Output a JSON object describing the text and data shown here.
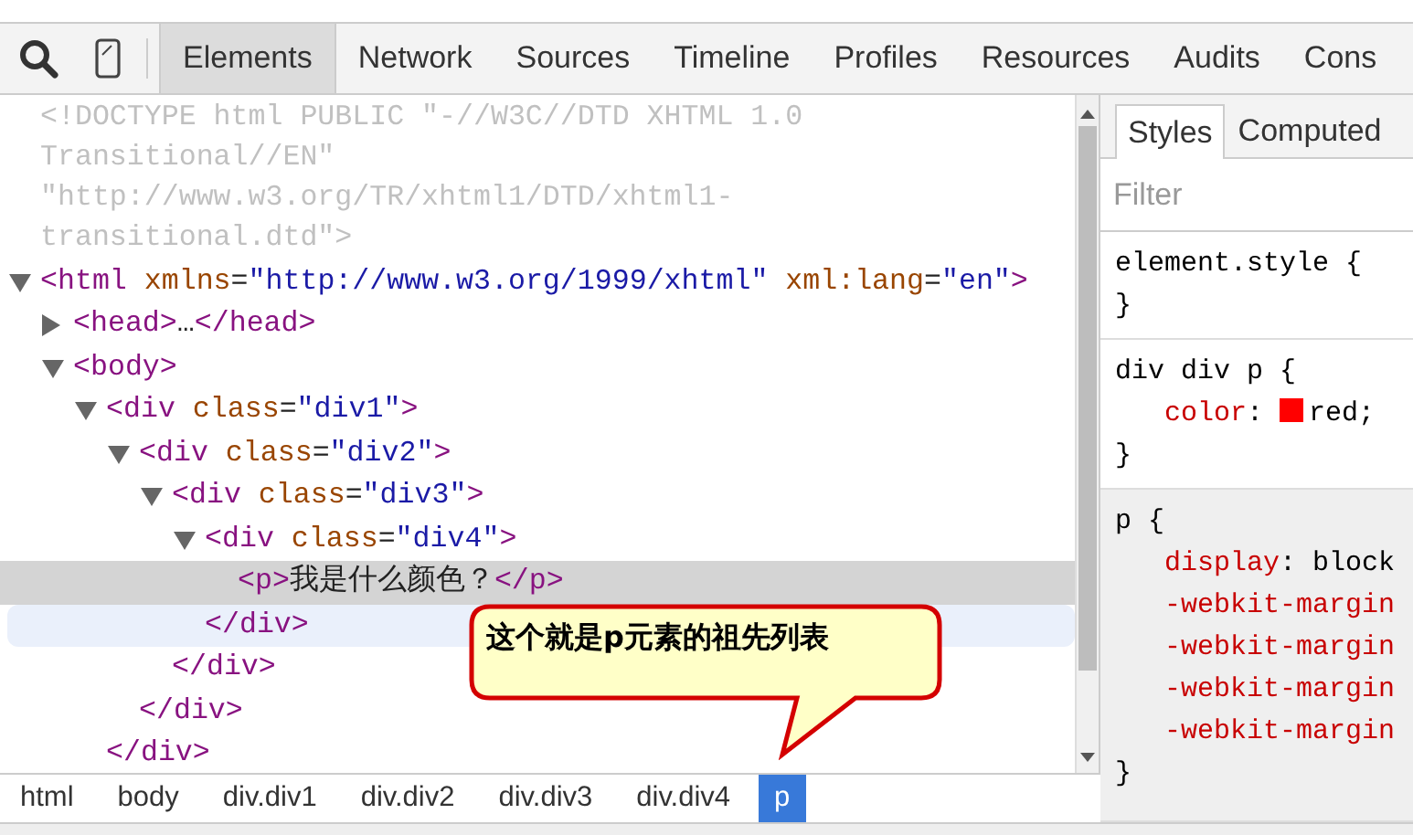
{
  "toolbar": {
    "tabs": [
      {
        "label": "Elements",
        "selected": true
      },
      {
        "label": "Network",
        "selected": false
      },
      {
        "label": "Sources",
        "selected": false
      },
      {
        "label": "Timeline",
        "selected": false
      },
      {
        "label": "Profiles",
        "selected": false
      },
      {
        "label": "Resources",
        "selected": false
      },
      {
        "label": "Audits",
        "selected": false
      },
      {
        "label": "Cons",
        "selected": false
      }
    ]
  },
  "elements_panel": {
    "nodes": [
      {
        "kind": "doctype",
        "selected": false,
        "tokens": [
          {
            "kind": "doctype",
            "text": "<!DOCTYPE html PUBLIC \"-//W3C//DTD XHTML 1.0 Transitional//EN\" \"http://www.w3.org/TR/xhtml1/DTD/xhtml1-transitional.dtd\">"
          }
        ]
      },
      {
        "kind": "element",
        "expanded": true,
        "selected": false,
        "tokens": [
          {
            "kind": "tag",
            "text": "<html"
          },
          {
            "kind": "attr",
            "text": " xmlns"
          },
          {
            "kind": "punct",
            "text": "="
          },
          {
            "kind": "value",
            "text": "\"http://www.w3.org/1999/xhtml\""
          },
          {
            "kind": "attr",
            "text": " xml:lang"
          },
          {
            "kind": "punct",
            "text": "="
          },
          {
            "kind": "value",
            "text": "\"en\""
          },
          {
            "kind": "tag",
            "text": ">"
          }
        ],
        "children": [
          {
            "kind": "element",
            "expanded": false,
            "selected": false,
            "tokens": [
              {
                "kind": "tag",
                "text": "<head>"
              },
              {
                "kind": "text",
                "text": "…"
              },
              {
                "kind": "tag",
                "text": "</head>"
              }
            ]
          },
          {
            "kind": "element",
            "expanded": true,
            "selected": false,
            "tokens": [
              {
                "kind": "tag",
                "text": "<body>"
              }
            ],
            "children": [
              {
                "kind": "element",
                "expanded": true,
                "selected": false,
                "tokens": [
                  {
                    "kind": "tag",
                    "text": "<div"
                  },
                  {
                    "kind": "attr",
                    "text": " class"
                  },
                  {
                    "kind": "punct",
                    "text": "="
                  },
                  {
                    "kind": "value",
                    "text": "\"div1\""
                  },
                  {
                    "kind": "tag",
                    "text": ">"
                  }
                ],
                "closing": {
                  "hovered": false,
                  "tokens": [
                    {
                      "kind": "tag",
                      "text": "</div>"
                    }
                  ]
                },
                "children": [
                  {
                    "kind": "element",
                    "expanded": true,
                    "selected": false,
                    "tokens": [
                      {
                        "kind": "tag",
                        "text": "<div"
                      },
                      {
                        "kind": "attr",
                        "text": " class"
                      },
                      {
                        "kind": "punct",
                        "text": "="
                      },
                      {
                        "kind": "value",
                        "text": "\"div2\""
                      },
                      {
                        "kind": "tag",
                        "text": ">"
                      }
                    ],
                    "closing": {
                      "hovered": false,
                      "tokens": [
                        {
                          "kind": "tag",
                          "text": "</div>"
                        }
                      ]
                    },
                    "children": [
                      {
                        "kind": "element",
                        "expanded": true,
                        "selected": false,
                        "tokens": [
                          {
                            "kind": "tag",
                            "text": "<div"
                          },
                          {
                            "kind": "attr",
                            "text": " class"
                          },
                          {
                            "kind": "punct",
                            "text": "="
                          },
                          {
                            "kind": "value",
                            "text": "\"div3\""
                          },
                          {
                            "kind": "tag",
                            "text": ">"
                          }
                        ],
                        "closing": {
                          "hovered": false,
                          "tokens": [
                            {
                              "kind": "tag",
                              "text": "</div>"
                            }
                          ]
                        },
                        "children": [
                          {
                            "kind": "element",
                            "expanded": true,
                            "selected": false,
                            "tokens": [
                              {
                                "kind": "tag",
                                "text": "<div"
                              },
                              {
                                "kind": "attr",
                                "text": " class"
                              },
                              {
                                "kind": "punct",
                                "text": "="
                              },
                              {
                                "kind": "value",
                                "text": "\"div4\""
                              },
                              {
                                "kind": "tag",
                                "text": ">"
                              }
                            ],
                            "closing": {
                              "hovered": true,
                              "tokens": [
                                {
                                  "kind": "tag",
                                  "text": "</div>"
                                }
                              ]
                            },
                            "children": [
                              {
                                "kind": "leaf",
                                "selected": true,
                                "tokens": [
                                  {
                                    "kind": "tag",
                                    "text": "<p>"
                                  },
                                  {
                                    "kind": "text",
                                    "text": "我是什么颜色？"
                                  },
                                  {
                                    "kind": "tag",
                                    "text": "</p>"
                                  }
                                ]
                              }
                            ]
                          }
                        ]
                      }
                    ]
                  }
                ]
              }
            ]
          }
        ]
      }
    ]
  },
  "styles_panel": {
    "tabs": [
      {
        "label": "Styles",
        "selected": true
      },
      {
        "label": "Computed",
        "selected": false
      }
    ],
    "filter": {
      "placeholder": "Filter"
    },
    "rules": [
      {
        "kind": "author",
        "header": "element.style {",
        "footer": "}"
      },
      {
        "kind": "author",
        "header": "div div p {",
        "footer": "}",
        "declarations": [
          {
            "name": "color",
            "separator": ":",
            "value": "red;",
            "color": "#ff0000"
          }
        ]
      },
      {
        "kind": "user_agent",
        "header": "p {",
        "footer": "}",
        "declarations": [
          {
            "name": "display",
            "separator": ":",
            "value": "block"
          },
          {
            "name": "-webkit-margin"
          },
          {
            "name": "-webkit-margin"
          },
          {
            "name": "-webkit-margin"
          },
          {
            "name": "-webkit-margin"
          }
        ]
      }
    ]
  },
  "breadcrumbs": [
    {
      "label": "html",
      "selected": false
    },
    {
      "label": "body",
      "selected": false
    },
    {
      "label": "div.div1",
      "selected": false
    },
    {
      "label": "div.div2",
      "selected": false
    },
    {
      "label": "div.div3",
      "selected": false
    },
    {
      "label": "div.div4",
      "selected": false
    },
    {
      "label": "p",
      "selected": true
    }
  ],
  "callout": {
    "text": "这个就是p元素的祖先列表"
  }
}
